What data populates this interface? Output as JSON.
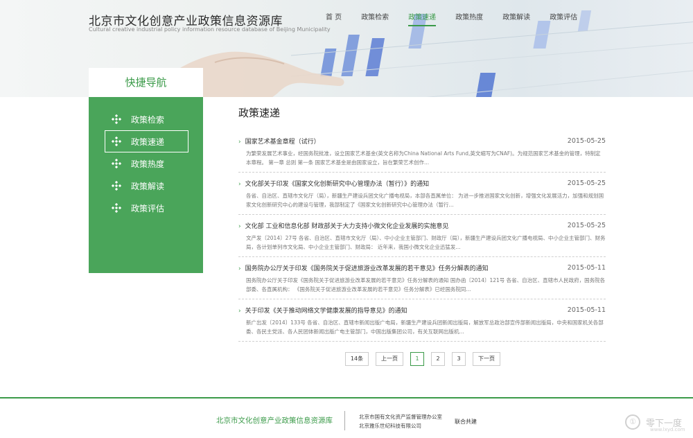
{
  "header": {
    "site_title": "北京市文化创意产业政策信息资源库",
    "site_subtitle": "Cultural creative industrial policy information resource database of Beijing Municipality"
  },
  "nav": {
    "items": [
      {
        "label": "首 页"
      },
      {
        "label": "政策检索"
      },
      {
        "label": "政策速递"
      },
      {
        "label": "政策热度"
      },
      {
        "label": "政策解读"
      },
      {
        "label": "政策评估"
      }
    ],
    "active_index": 2
  },
  "sidebar": {
    "heading": "快捷导航",
    "items": [
      {
        "label": "政策检索"
      },
      {
        "label": "政策速递"
      },
      {
        "label": "政策热度"
      },
      {
        "label": "政策解读"
      },
      {
        "label": "政策评估"
      }
    ],
    "active_index": 1
  },
  "main": {
    "title": "政策速递",
    "articles": [
      {
        "title": "国家艺术基金章程（试行）",
        "date": "2015-05-25",
        "summary": "为繁荣发展艺术事业，经国务院批准，设立国家艺术基金(英文名称为China National Arts Fund,英文缩写为CNAF)。为规范国家艺术基金的管理，特制定本章程。 第一章 总则 第一条 国家艺术基金是由国家设立，旨在繁荣艺术创作..."
      },
      {
        "title": "文化部关于印发《国家文化创新研究中心管理办法（暂行）》的通知",
        "date": "2015-05-25",
        "summary": "各省、自治区、直辖市文化厅（局），新疆生产建设兵团文化广播电视局，本部各直属单位： 为进一步推进国家文化创新，增强文化发展活力，加强和规划国家文化创新研究中心的建设与管理，我部制定了《国家文化创新研究中心管理办法（暂行..."
      },
      {
        "title": "文化部 工业和信息化部 财政部关于大力支持小微文化企业发展的实施意见",
        "date": "2015-05-25",
        "summary": "文产发〔2014〕27号 各省、自治区、直辖市文化厅（局）、中小企业主管部门、财政厅（局），新疆生产建设兵团文化广播电视局、中小企业主管部门、财务局，各计划单列市文化局、中小企业主管部门、财政局： 近年来，我国小微文化企业迅猛发..."
      },
      {
        "title": "国务院办公厅关于印发《国务院关于促进旅游业改革发展的若干意见》任务分解表的通知",
        "date": "2015-05-11",
        "summary": "国务院办公厅关于印发《国务院关于促进旅游业改革发展的若干意见》任务分解表的通知 国办函〔2014〕121号 各省、自治区、直辖市人民政府，国务院各部委、各直属机构： 《国务院关于促进旅游业改革发展的若干意见》任务分解表》已经国务院同..."
      },
      {
        "title": "关于印发《关于推动网络文学健康发展的指导意见》的通知",
        "date": "2015-05-11",
        "summary": "新广出发〔2014〕133号 各省、自治区、直辖市新闻出版广电局，新疆生产建设兵团新闻出版局，解放军总政治部宣传部新闻出版局，中央和国家机关各部委、各民主党派、各人民团体新闻出版广电主管部门，中国出版集团公司，有关互联网出版机..."
      }
    ]
  },
  "pagination": {
    "count_label": "14条",
    "prev_label": "上一页",
    "pages": [
      "1",
      "2",
      "3"
    ],
    "current_index": 0,
    "next_label": "下一页"
  },
  "footer": {
    "title": "北京市文化创意产业政策信息资源库",
    "org_1": "北京市国有文化资产监督管理办公室",
    "org_2": "北京雅乐世纪科技有限公司",
    "joint": "联合共建"
  },
  "watermark": {
    "text": "零下一度",
    "url": "www.lxyd.com"
  },
  "colors": {
    "accent": "#3a9a48",
    "sidebar_bg": "#4aa55a"
  },
  "icons": {
    "sidebar_item_icon": "diamond-dots-icon",
    "article_bullet_icon": "chevron-right-icon"
  }
}
